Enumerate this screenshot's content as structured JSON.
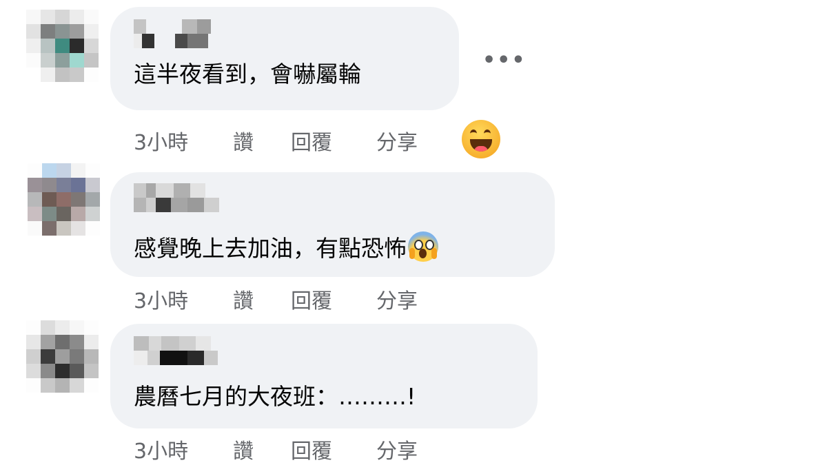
{
  "comments": [
    {
      "text": "這半夜看到，會嚇屬輪",
      "time": "3小時",
      "like": "讚",
      "reply": "回覆",
      "share": "分享"
    },
    {
      "text": "感覺晚上去加油，有點恐怖",
      "time": "3小時",
      "like": "讚",
      "reply": "回覆",
      "share": "分享"
    },
    {
      "text": "農曆七月的大夜班：………!",
      "time": "3小時",
      "like": "讚",
      "reply": "回覆",
      "share": "分享"
    }
  ],
  "more_label": "•••",
  "reaction_icon": "laughing-emoji",
  "inline_emoji": "screaming-in-fear-emoji",
  "colors": {
    "bubble": "#f0f2f5",
    "meta_text": "#65676b",
    "body_text": "#050505"
  }
}
